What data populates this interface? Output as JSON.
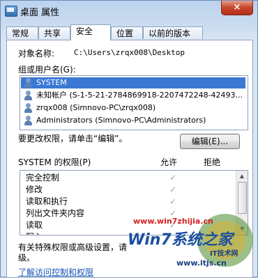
{
  "window": {
    "title": "桌面 属性",
    "close_label": "×"
  },
  "tabs": [
    {
      "label": "常规"
    },
    {
      "label": "共享"
    },
    {
      "label": "安全"
    },
    {
      "label": "位置"
    },
    {
      "label": "以前的版本"
    }
  ],
  "object": {
    "label": "对象名称:",
    "value": "C:\\Users\\zrqx008\\Desktop"
  },
  "groups": {
    "label": "组或用户名(G):",
    "items": [
      {
        "name": "SYSTEM"
      },
      {
        "name": "未知帐户 (S-1-5-21-2784869918-2207472248-42493..."
      },
      {
        "name": "zrqx008 (Simnovo-PC\\zrqx008)"
      },
      {
        "name": "Administrators (Simnovo-PC\\Administrators)"
      }
    ]
  },
  "edit": {
    "prompt": "要更改权限，请单击“编辑”。",
    "button_label": "编辑(E)..."
  },
  "permissions": {
    "title": "SYSTEM 的权限(P)",
    "allow_header": "允许",
    "deny_header": "拒绝",
    "rows": [
      {
        "name": "完全控制",
        "allow": "✓"
      },
      {
        "name": "修改",
        "allow": "✓"
      },
      {
        "name": "读取和执行",
        "allow": "✓"
      },
      {
        "name": "列出文件夹内容",
        "allow": "✓"
      },
      {
        "name": "读取",
        "allow": "✓"
      },
      {
        "name": "写入",
        "allow": "✓"
      }
    ]
  },
  "advanced": {
    "text_line1": "有关特殊权限或高级设置，请",
    "text_line2": "级。"
  },
  "footer_link": "了解访问控制和权限",
  "watermark": {
    "url1": "www.win7zhijia.cn",
    "brand": "Win7系统之家",
    "url2": "www.itjs.cn",
    "badge": "IT技术网"
  }
}
